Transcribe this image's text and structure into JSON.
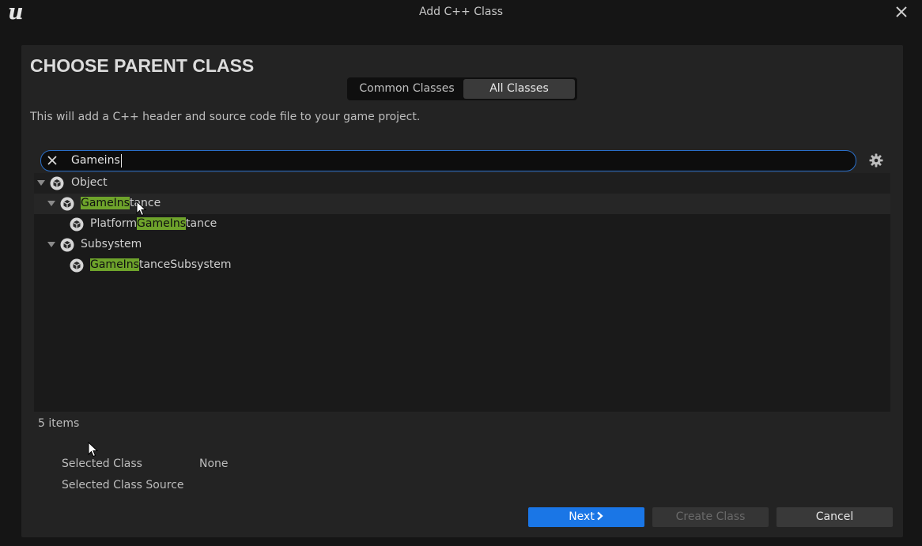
{
  "window": {
    "title": "Add C++ Class",
    "logo_text": "u"
  },
  "header": {
    "title": "CHOOSE PARENT CLASS",
    "description": "This will add a C++ header and source code file to your game project."
  },
  "tabs": [
    {
      "label": "Common Classes",
      "selected": false
    },
    {
      "label": "All Classes",
      "selected": true
    }
  ],
  "search": {
    "value": "Gameins"
  },
  "tree": {
    "items": [
      {
        "level": 0,
        "expanded": true,
        "pre": "",
        "match": "",
        "post": "Object"
      },
      {
        "level": 1,
        "expanded": true,
        "pre": "",
        "match": "GameIns",
        "post": "tance"
      },
      {
        "level": 2,
        "expanded": false,
        "pre": "Platform",
        "match": "GameIns",
        "post": "tance"
      },
      {
        "level": 1,
        "expanded": true,
        "pre": "",
        "match": "",
        "post": "Subsystem"
      },
      {
        "level": 2,
        "expanded": false,
        "pre": "",
        "match": "GameIns",
        "post": "tanceSubsystem"
      }
    ]
  },
  "status": {
    "item_count": "5 items"
  },
  "selection": {
    "class_label": "Selected Class",
    "class_value": "None",
    "source_label": "Selected Class Source",
    "source_value": ""
  },
  "buttons": {
    "next": "Next",
    "create": "Create Class",
    "cancel": "Cancel"
  },
  "colors": {
    "accent": "#1a76e6",
    "search_border": "#2a6fc9",
    "highlight": "#6ea32b",
    "background": "#151515",
    "panel": "#232323"
  },
  "icons": [
    "close-icon",
    "clear-search-icon",
    "gear-icon",
    "class-icon",
    "expand-arrow-icon",
    "chevron-right-icon",
    "mouse-cursor-icon"
  ]
}
